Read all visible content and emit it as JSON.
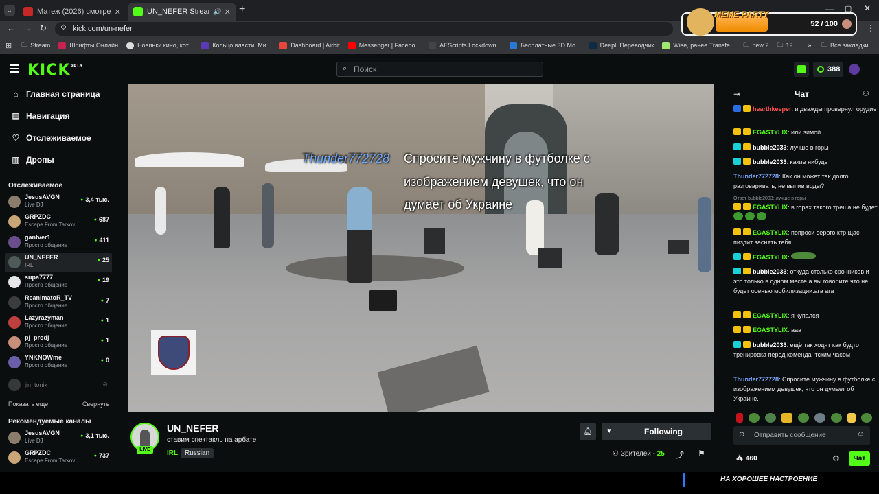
{
  "browser": {
    "tabs": [
      {
        "label": "Матеж (2026) смотреть онлай"
      },
      {
        "label": "UN_NEFER Stream - Watch"
      }
    ],
    "new_tab_symbol": "+",
    "url": "kick.com/un-nefer",
    "bookmarks": [
      {
        "label": "Stream"
      },
      {
        "label": "Шрифты Онлайн"
      },
      {
        "label": "Новинки кино, кот..."
      },
      {
        "label": "Кольцо власти. Ми..."
      },
      {
        "label": "Dashboard | Airbit"
      },
      {
        "label": "Messenger | Facebo..."
      },
      {
        "label": "AEScripts Lockdown..."
      },
      {
        "label": "Бесплатные 3D Мо..."
      },
      {
        "label": "DeepL Переводчик"
      },
      {
        "label": "Wise, ранее Transfe..."
      },
      {
        "label": "new 2"
      },
      {
        "label": "19"
      }
    ],
    "all_bookmarks": "Все закладки",
    "extension": {
      "title": "MEME PARTY",
      "counter": "52 / 100"
    }
  },
  "kick": {
    "logo": "KICK",
    "logo_beta": "BETA",
    "search_placeholder": "Поиск",
    "points": "388",
    "nav": [
      {
        "label": "Главная страница",
        "icon": "home-icon"
      },
      {
        "label": "Навигация",
        "icon": "compass-icon"
      },
      {
        "label": "Отслеживаемое",
        "icon": "heart-icon"
      },
      {
        "label": "Дропы",
        "icon": "gift-icon"
      }
    ],
    "following_header": "Отслеживаемое",
    "following": [
      {
        "name": "JesusAVGN",
        "category": "Live DJ",
        "viewers": "3,4 тыс.",
        "color": "#8a7d6b"
      },
      {
        "name": "GRPZDC",
        "category": "Escape From Tarkov",
        "viewers": "687",
        "color": "#c9a678"
      },
      {
        "name": "gantver1",
        "category": "Просто общение",
        "viewers": "411",
        "color": "#6a4e8c"
      },
      {
        "name": "UN_NEFER",
        "category": "IRL",
        "viewers": "25",
        "color": "#4f5a56"
      },
      {
        "name": "supa7777",
        "category": "Просто общение",
        "viewers": "19",
        "color": "#e6e6e6"
      },
      {
        "name": "ReanimatoR_TV",
        "category": "Просто общение",
        "viewers": "7",
        "color": "#3c3c3c"
      },
      {
        "name": "Lazyrazyman",
        "category": "Просто общение",
        "viewers": "1",
        "color": "#c04040"
      },
      {
        "name": "pj_prodj",
        "category": "Просто общение",
        "viewers": "1",
        "color": "#c98f7a"
      },
      {
        "name": "YNKNOWme",
        "category": "Просто общение",
        "viewers": "0",
        "color": "#6a5ea8"
      }
    ],
    "offline_channel": "jin_tonik",
    "show_more": "Показать еще",
    "collapse": "Свернуть",
    "recommended_header": "Рекомендуемые каналы",
    "recommended": [
      {
        "name": "JesusAVGN",
        "category": "Live DJ",
        "viewers": "3,1 тыс.",
        "color": "#8a7d6b"
      },
      {
        "name": "GRPZDC",
        "category": "Escape From Tarkov",
        "viewers": "737",
        "color": "#c9a678"
      }
    ]
  },
  "video": {
    "overlay_user": "Thunder772728",
    "overlay_text_line1": "Спросите мужчину в футболке с",
    "overlay_text_line2": "изображением девушек, что он",
    "overlay_text_line3": "думает об Украине"
  },
  "stream": {
    "channel": "UN_NEFER",
    "title": "ставим спектакль на арбате",
    "category": "IRL",
    "tag": "Russian",
    "live": "LIVE",
    "follow_label": "Following",
    "viewers_label": "Зрителей -",
    "viewers": "25"
  },
  "chat": {
    "title": "Чат",
    "messages": [
      {
        "user": "hearthkeeper",
        "text": ": и дважды провернул орудие",
        "ucolor": "u-r"
      },
      {
        "user": "EGASTYLIX",
        "text": ": или зимой",
        "ucolor": "u-g"
      },
      {
        "user": "bubble2033",
        "text": ": лучше в горы",
        "ucolor": "u-w"
      },
      {
        "user": "bubble2033",
        "text": ": какие нибудь",
        "ucolor": "u-w"
      },
      {
        "user": "Thunder772728",
        "text": ": Как он может так долго разговаривать, не выпив воды?",
        "ucolor": "u-bl"
      },
      {
        "reply": "Ответ bubble2033: лучше в горы",
        "user": "EGASTYLIX",
        "text": ": в горах такого треша не будет",
        "ucolor": "u-g"
      },
      {
        "user": "EGASTYLIX",
        "text": ": попроси серого ктр щас пиздит заснять тебя",
        "ucolor": "u-g"
      },
      {
        "user": "EGASTYLIX",
        "text": ":",
        "ucolor": "u-g"
      },
      {
        "user": "bubble2033",
        "text": ": откуда столько срочников и это только в одном месте,а вы говорите что не будет осенью мобилизации.ага ага",
        "ucolor": "u-w"
      },
      {
        "user": "EGASTYLIX",
        "text": ": я купался",
        "ucolor": "u-g"
      },
      {
        "user": "EGASTYLIX",
        "text": ": ааа",
        "ucolor": "u-g"
      },
      {
        "user": "bubble2033",
        "text": ": ещё так ходят как будто тренировка перед комендантским часом",
        "ucolor": "u-w"
      },
      {
        "user": "Thunder772728",
        "text": ": Спросите мужчину в футболке с изображением девушек, что он думает об Украине.",
        "ucolor": "u-bl"
      }
    ],
    "input_placeholder": "Отправить сообщение",
    "points": "460",
    "send_label": "Чат"
  },
  "bottom": {
    "text": "НА ХОРОШЕЕ НАСТРОЕНИЕ"
  }
}
